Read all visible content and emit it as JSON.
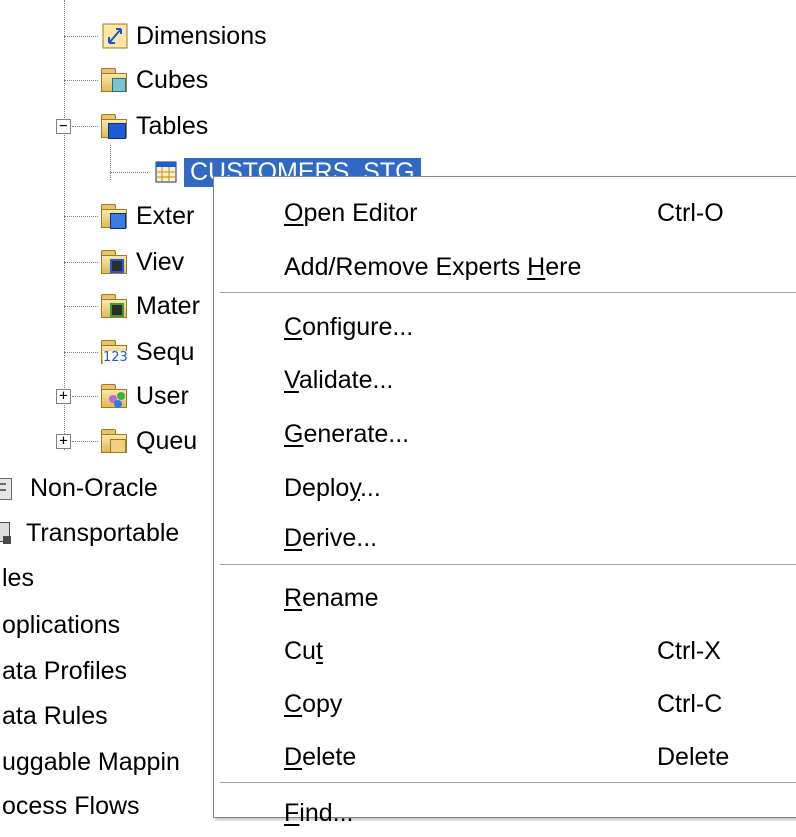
{
  "tree": {
    "items": [
      {
        "label": "Dimensions",
        "icon": "dimensions-folder-icon"
      },
      {
        "label": "Cubes",
        "icon": "cubes-folder-icon"
      },
      {
        "label": "Tables",
        "icon": "tables-folder-icon",
        "expander": "−"
      },
      {
        "label": "CUSTOMERS_STG",
        "icon": "table-icon"
      },
      {
        "label": "Exter",
        "icon": "external-tables-folder-icon"
      },
      {
        "label": "Viev",
        "icon": "views-folder-icon"
      },
      {
        "label": "Mater",
        "icon": "materialized-views-folder-icon"
      },
      {
        "label": "Sequ",
        "icon": "sequences-folder-icon"
      },
      {
        "label": "User",
        "icon": "user-defined-types-folder-icon",
        "expander": "+"
      },
      {
        "label": "Queu",
        "icon": "queues-folder-icon",
        "expander": "+"
      },
      {
        "label": "Non-Oracle",
        "icon": "non-oracle-icon"
      },
      {
        "label": "Transportable",
        "icon": "transportable-icon"
      },
      {
        "label": "les"
      },
      {
        "label": "oplications"
      },
      {
        "label": "ata Profiles"
      },
      {
        "label": "ata Rules"
      },
      {
        "label": "uggable Mappin"
      },
      {
        "label": "ocess Flows"
      }
    ]
  },
  "context_menu": {
    "items": [
      {
        "pre": "",
        "key": "O",
        "post": "pen Editor",
        "shortcut": "Ctrl-O"
      },
      {
        "pre": "Add/Remove Experts ",
        "key": "H",
        "post": "ere",
        "shortcut": ""
      },
      {
        "pre": "",
        "key": "C",
        "post": "onfigure...",
        "shortcut": ""
      },
      {
        "pre": "",
        "key": "V",
        "post": "alidate...",
        "shortcut": ""
      },
      {
        "pre": "",
        "key": "G",
        "post": "enerate...",
        "shortcut": ""
      },
      {
        "pre": "Deplo",
        "key": "y",
        "post": "...",
        "shortcut": ""
      },
      {
        "pre": "",
        "key": "D",
        "post": "erive...",
        "shortcut": ""
      },
      {
        "pre": "",
        "key": "R",
        "post": "ename",
        "shortcut": ""
      },
      {
        "pre": "Cu",
        "key": "t",
        "post": "",
        "shortcut": "Ctrl-X"
      },
      {
        "pre": "",
        "key": "C",
        "post": "opy",
        "shortcut": "Ctrl-C"
      },
      {
        "pre": "",
        "key": "D",
        "post": "elete",
        "shortcut": "Delete"
      },
      {
        "pre": "",
        "key": "F",
        "post": "ind...",
        "shortcut": ""
      }
    ]
  },
  "colors": {
    "selection": "#316ac5",
    "background": "#ffffff"
  }
}
